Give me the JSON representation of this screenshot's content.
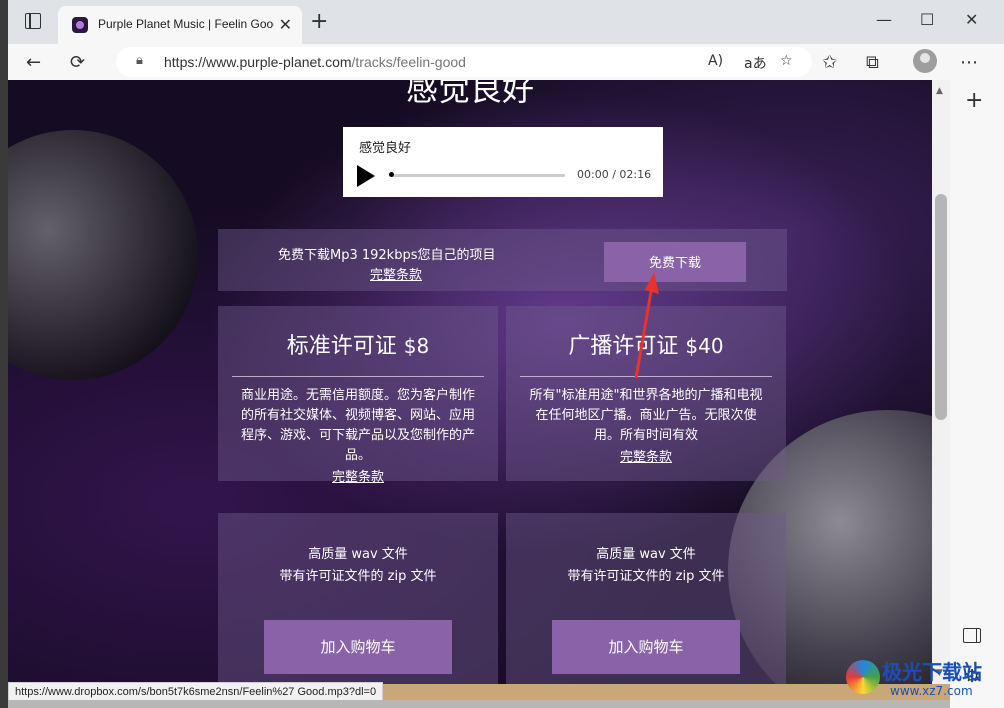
{
  "browser": {
    "tab_title": "Purple Planet Music | Feelin Good",
    "tab_close": "✕",
    "new_tab": "+",
    "url_host": "https://www.purple-planet.com",
    "url_path": "/tracks/feelin-good",
    "read_aloud": "A)",
    "translate": "aあ",
    "win_min": "—",
    "win_max": "☐",
    "win_close": "✕"
  },
  "page": {
    "title": "感觉良好",
    "player": {
      "track_name": "感觉良好",
      "time": "00:00 / 02:16",
      "progress": 0
    },
    "free": {
      "text": "免费下载Mp3 192kbps您自己的项目",
      "terms_link": "完整条款",
      "button": "免费下载"
    },
    "licenses": [
      {
        "title": "标准许可证",
        "price": "$8",
        "desc_lines": [
          "商业用途。无需信用额度。您为客户制作",
          "的所有社交媒体、视频博客、网站、应用",
          "程序、游戏、可下载产品以及您制作的产",
          "品。"
        ],
        "terms_link": "完整条款"
      },
      {
        "title": "广播许可证",
        "price": "$40",
        "desc_lines": [
          "所有\"标准用途\"和世界各地的广播和电视",
          "在任何地区广播。商业广告。无限次使",
          "用。所有时间有效"
        ],
        "terms_link": "完整条款"
      }
    ],
    "files": [
      {
        "line1": "高质量 wav 文件",
        "line2": "带有许可证文件的 zip 文件",
        "button": "加入购物车"
      },
      {
        "line1": "高质量 wav 文件",
        "line2": "带有许可证文件的 zip 文件",
        "button": "加入购物车"
      }
    ]
  },
  "status_bar": "https://www.dropbox.com/s/bon5t7k6sme2nsn/Feelin%27 Good.mp3?dl=0",
  "watermark": {
    "line1": "极光下载站",
    "line2": "www.xz7.com"
  },
  "colors": {
    "accent_button": "#8a62a8",
    "arrow": "#e8322b"
  }
}
